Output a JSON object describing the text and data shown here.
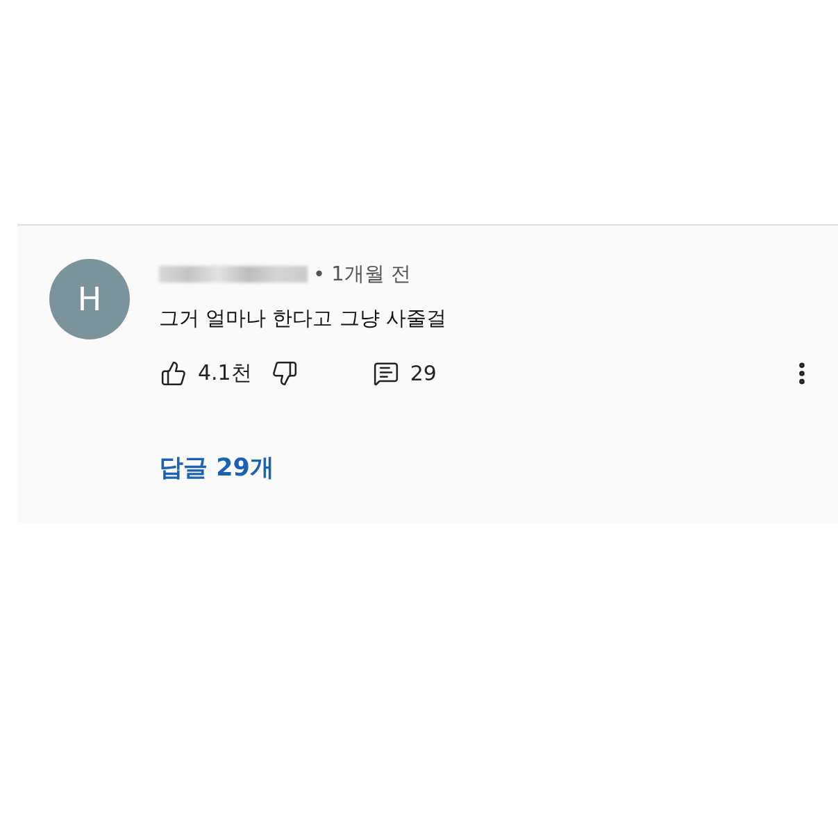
{
  "comment": {
    "avatar_letter": "H",
    "time": "• 1개월 전",
    "text": "그거 얼마나 한다고 그냥 사줄걸",
    "likes": "4.1천",
    "replies_count": "29",
    "replies_link": "답글 29개"
  }
}
